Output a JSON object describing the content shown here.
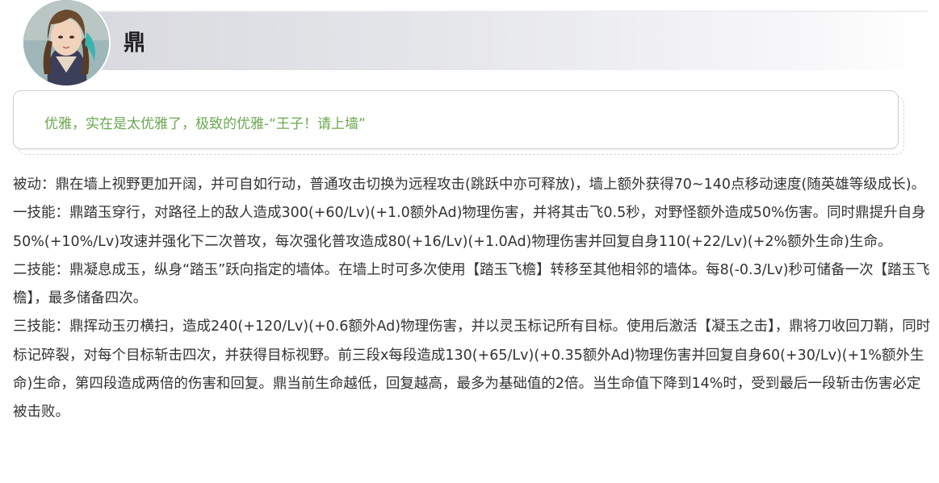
{
  "hero": {
    "name": "鼎",
    "avatar_icon": "hero-portrait"
  },
  "quote": {
    "text": "优雅，实在是太优雅了，极致的优雅-“王子！请上墙”",
    "color": "#6aa84f"
  },
  "skills": {
    "passive": "被动：鼎在墙上视野更加开阔，并可自如行动，普通攻击切换为远程攻击(跳跃中亦可释放)，墙上额外获得70~140点移动速度(随英雄等级成长)。",
    "skill1": "一技能：鼎踏玉穿行，对路径上的敌人造成300(+60/Lv)(+1.0额外Ad)物理伤害，并将其击飞0.5秒，对野怪额外造成50%伤害。同时鼎提升自身50%(+10%/Lv)攻速并强化下二次普攻，每次强化普攻造成80(+16/Lv)(+1.0Ad)物理伤害并回复自身110(+22/Lv)(+2%额外生命)生命。",
    "skill2": "二技能：鼎凝息成玉，纵身“踏玉”跃向指定的墙体。在墙上时可多次使用【踏玉飞檐】转移至其他相邻的墙体。每8(-0.3/Lv)秒可储备一次【踏玉飞檐】，最多储备四次。",
    "skill3": "三技能：鼎挥动玉刃横扫，造成240(+120/Lv)(+0.6额外Ad)物理伤害，并以灵玉标记所有目标。使用后激活【凝玉之击】，鼎将刀收回刀鞘，同时标记碎裂，对每个目标斩击四次，并获得目标视野。前三段x每段造成130(+65/Lv)(+0.35额外Ad)物理伤害并回复自身60(+30/Lv)(+1%额外生命)生命，第四段造成两倍的伤害和回复。鼎当前生命越低，回复越高，最多为基础值的2倍。当生命值下降到14%时，受到最后一段斩击伤害必定被击败。"
  }
}
